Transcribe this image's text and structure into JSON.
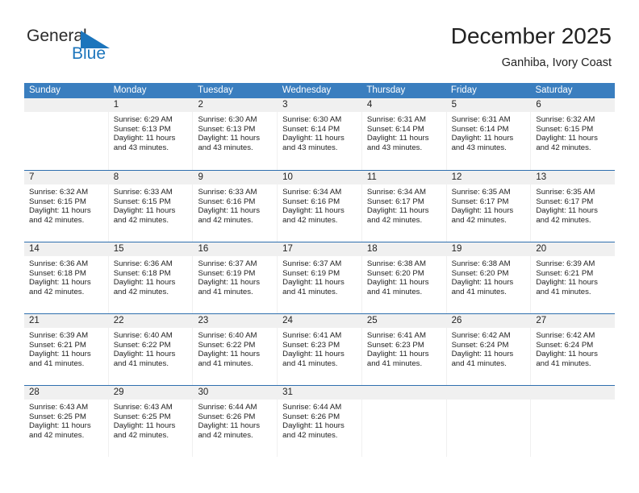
{
  "brand": {
    "name_top": "General",
    "name_bottom": "Blue",
    "accent_color": "#1c75bc"
  },
  "header": {
    "title": "December 2025",
    "subtitle": "Ganhiba, Ivory Coast"
  },
  "calendar": {
    "header_bg": "#3a7ebf",
    "row_rule_color": "#2f6fae",
    "daynum_bg": "#f0f0f0",
    "weekdays": [
      "Sunday",
      "Monday",
      "Tuesday",
      "Wednesday",
      "Thursday",
      "Friday",
      "Saturday"
    ],
    "weeks": [
      [
        {
          "day": "",
          "sunrise": "",
          "sunset": "",
          "daylight_line1": "",
          "daylight_line2": ""
        },
        {
          "day": "1",
          "sunrise": "Sunrise: 6:29 AM",
          "sunset": "Sunset: 6:13 PM",
          "daylight_line1": "Daylight: 11 hours",
          "daylight_line2": "and 43 minutes."
        },
        {
          "day": "2",
          "sunrise": "Sunrise: 6:30 AM",
          "sunset": "Sunset: 6:13 PM",
          "daylight_line1": "Daylight: 11 hours",
          "daylight_line2": "and 43 minutes."
        },
        {
          "day": "3",
          "sunrise": "Sunrise: 6:30 AM",
          "sunset": "Sunset: 6:14 PM",
          "daylight_line1": "Daylight: 11 hours",
          "daylight_line2": "and 43 minutes."
        },
        {
          "day": "4",
          "sunrise": "Sunrise: 6:31 AM",
          "sunset": "Sunset: 6:14 PM",
          "daylight_line1": "Daylight: 11 hours",
          "daylight_line2": "and 43 minutes."
        },
        {
          "day": "5",
          "sunrise": "Sunrise: 6:31 AM",
          "sunset": "Sunset: 6:14 PM",
          "daylight_line1": "Daylight: 11 hours",
          "daylight_line2": "and 43 minutes."
        },
        {
          "day": "6",
          "sunrise": "Sunrise: 6:32 AM",
          "sunset": "Sunset: 6:15 PM",
          "daylight_line1": "Daylight: 11 hours",
          "daylight_line2": "and 42 minutes."
        }
      ],
      [
        {
          "day": "7",
          "sunrise": "Sunrise: 6:32 AM",
          "sunset": "Sunset: 6:15 PM",
          "daylight_line1": "Daylight: 11 hours",
          "daylight_line2": "and 42 minutes."
        },
        {
          "day": "8",
          "sunrise": "Sunrise: 6:33 AM",
          "sunset": "Sunset: 6:15 PM",
          "daylight_line1": "Daylight: 11 hours",
          "daylight_line2": "and 42 minutes."
        },
        {
          "day": "9",
          "sunrise": "Sunrise: 6:33 AM",
          "sunset": "Sunset: 6:16 PM",
          "daylight_line1": "Daylight: 11 hours",
          "daylight_line2": "and 42 minutes."
        },
        {
          "day": "10",
          "sunrise": "Sunrise: 6:34 AM",
          "sunset": "Sunset: 6:16 PM",
          "daylight_line1": "Daylight: 11 hours",
          "daylight_line2": "and 42 minutes."
        },
        {
          "day": "11",
          "sunrise": "Sunrise: 6:34 AM",
          "sunset": "Sunset: 6:17 PM",
          "daylight_line1": "Daylight: 11 hours",
          "daylight_line2": "and 42 minutes."
        },
        {
          "day": "12",
          "sunrise": "Sunrise: 6:35 AM",
          "sunset": "Sunset: 6:17 PM",
          "daylight_line1": "Daylight: 11 hours",
          "daylight_line2": "and 42 minutes."
        },
        {
          "day": "13",
          "sunrise": "Sunrise: 6:35 AM",
          "sunset": "Sunset: 6:17 PM",
          "daylight_line1": "Daylight: 11 hours",
          "daylight_line2": "and 42 minutes."
        }
      ],
      [
        {
          "day": "14",
          "sunrise": "Sunrise: 6:36 AM",
          "sunset": "Sunset: 6:18 PM",
          "daylight_line1": "Daylight: 11 hours",
          "daylight_line2": "and 42 minutes."
        },
        {
          "day": "15",
          "sunrise": "Sunrise: 6:36 AM",
          "sunset": "Sunset: 6:18 PM",
          "daylight_line1": "Daylight: 11 hours",
          "daylight_line2": "and 42 minutes."
        },
        {
          "day": "16",
          "sunrise": "Sunrise: 6:37 AM",
          "sunset": "Sunset: 6:19 PM",
          "daylight_line1": "Daylight: 11 hours",
          "daylight_line2": "and 41 minutes."
        },
        {
          "day": "17",
          "sunrise": "Sunrise: 6:37 AM",
          "sunset": "Sunset: 6:19 PM",
          "daylight_line1": "Daylight: 11 hours",
          "daylight_line2": "and 41 minutes."
        },
        {
          "day": "18",
          "sunrise": "Sunrise: 6:38 AM",
          "sunset": "Sunset: 6:20 PM",
          "daylight_line1": "Daylight: 11 hours",
          "daylight_line2": "and 41 minutes."
        },
        {
          "day": "19",
          "sunrise": "Sunrise: 6:38 AM",
          "sunset": "Sunset: 6:20 PM",
          "daylight_line1": "Daylight: 11 hours",
          "daylight_line2": "and 41 minutes."
        },
        {
          "day": "20",
          "sunrise": "Sunrise: 6:39 AM",
          "sunset": "Sunset: 6:21 PM",
          "daylight_line1": "Daylight: 11 hours",
          "daylight_line2": "and 41 minutes."
        }
      ],
      [
        {
          "day": "21",
          "sunrise": "Sunrise: 6:39 AM",
          "sunset": "Sunset: 6:21 PM",
          "daylight_line1": "Daylight: 11 hours",
          "daylight_line2": "and 41 minutes."
        },
        {
          "day": "22",
          "sunrise": "Sunrise: 6:40 AM",
          "sunset": "Sunset: 6:22 PM",
          "daylight_line1": "Daylight: 11 hours",
          "daylight_line2": "and 41 minutes."
        },
        {
          "day": "23",
          "sunrise": "Sunrise: 6:40 AM",
          "sunset": "Sunset: 6:22 PM",
          "daylight_line1": "Daylight: 11 hours",
          "daylight_line2": "and 41 minutes."
        },
        {
          "day": "24",
          "sunrise": "Sunrise: 6:41 AM",
          "sunset": "Sunset: 6:23 PM",
          "daylight_line1": "Daylight: 11 hours",
          "daylight_line2": "and 41 minutes."
        },
        {
          "day": "25",
          "sunrise": "Sunrise: 6:41 AM",
          "sunset": "Sunset: 6:23 PM",
          "daylight_line1": "Daylight: 11 hours",
          "daylight_line2": "and 41 minutes."
        },
        {
          "day": "26",
          "sunrise": "Sunrise: 6:42 AM",
          "sunset": "Sunset: 6:24 PM",
          "daylight_line1": "Daylight: 11 hours",
          "daylight_line2": "and 41 minutes."
        },
        {
          "day": "27",
          "sunrise": "Sunrise: 6:42 AM",
          "sunset": "Sunset: 6:24 PM",
          "daylight_line1": "Daylight: 11 hours",
          "daylight_line2": "and 41 minutes."
        }
      ],
      [
        {
          "day": "28",
          "sunrise": "Sunrise: 6:43 AM",
          "sunset": "Sunset: 6:25 PM",
          "daylight_line1": "Daylight: 11 hours",
          "daylight_line2": "and 42 minutes."
        },
        {
          "day": "29",
          "sunrise": "Sunrise: 6:43 AM",
          "sunset": "Sunset: 6:25 PM",
          "daylight_line1": "Daylight: 11 hours",
          "daylight_line2": "and 42 minutes."
        },
        {
          "day": "30",
          "sunrise": "Sunrise: 6:44 AM",
          "sunset": "Sunset: 6:26 PM",
          "daylight_line1": "Daylight: 11 hours",
          "daylight_line2": "and 42 minutes."
        },
        {
          "day": "31",
          "sunrise": "Sunrise: 6:44 AM",
          "sunset": "Sunset: 6:26 PM",
          "daylight_line1": "Daylight: 11 hours",
          "daylight_line2": "and 42 minutes."
        },
        {
          "day": "",
          "sunrise": "",
          "sunset": "",
          "daylight_line1": "",
          "daylight_line2": ""
        },
        {
          "day": "",
          "sunrise": "",
          "sunset": "",
          "daylight_line1": "",
          "daylight_line2": ""
        },
        {
          "day": "",
          "sunrise": "",
          "sunset": "",
          "daylight_line1": "",
          "daylight_line2": ""
        }
      ]
    ]
  }
}
